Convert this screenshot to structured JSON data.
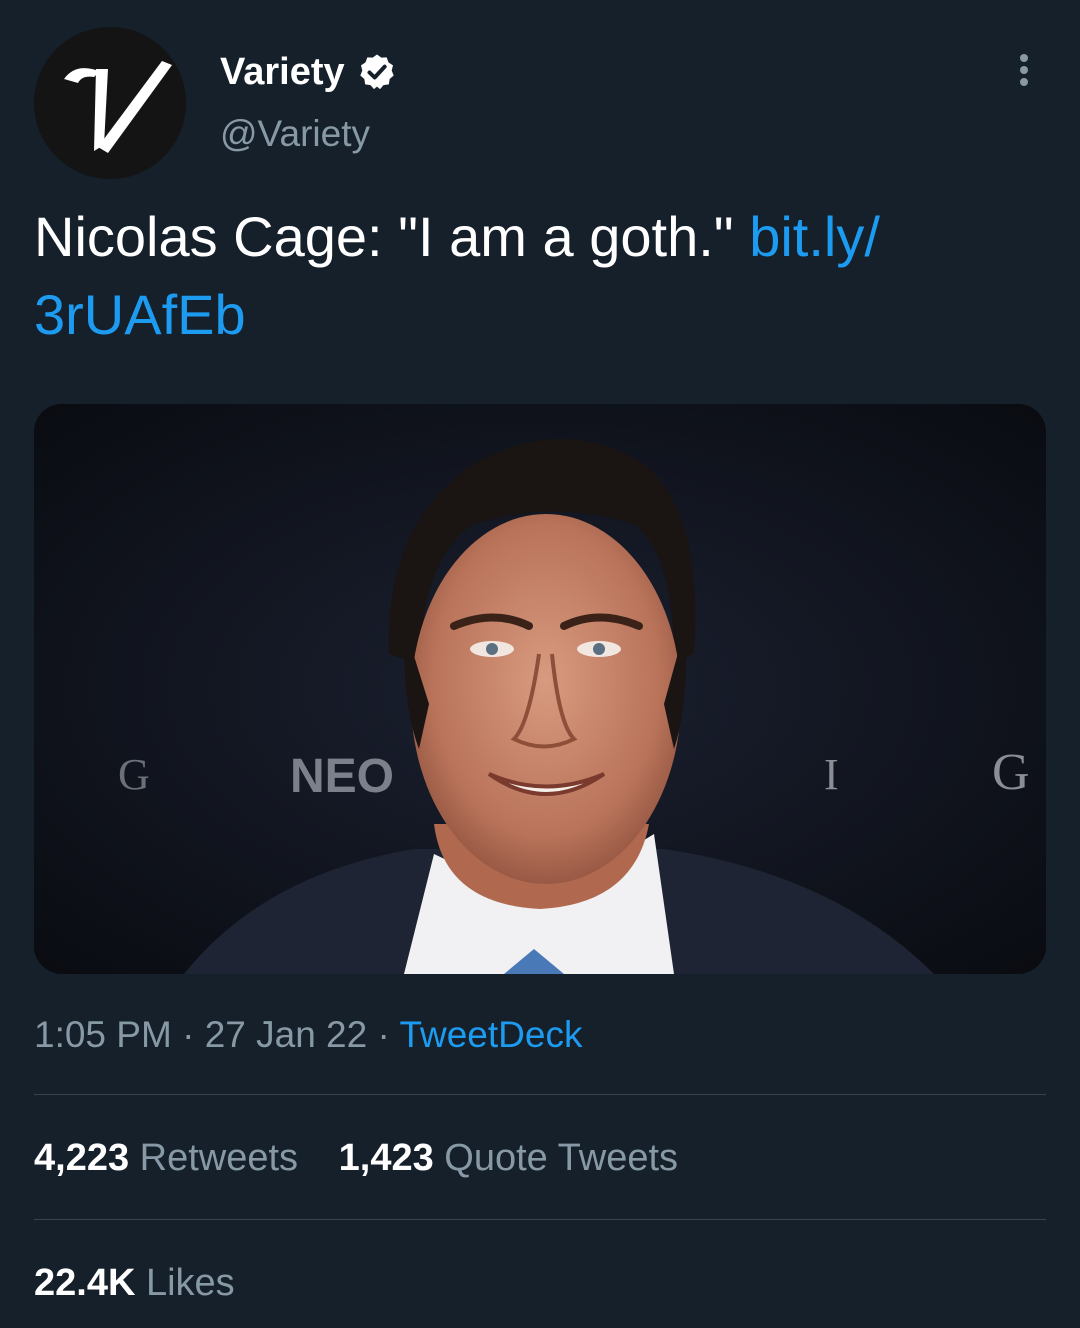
{
  "author": {
    "display_name": "Variety",
    "handle": "@Variety",
    "avatar_letter": "V"
  },
  "tweet": {
    "text": "Nicolas Cage: \"I am a goth.\" ",
    "link_line1": "bit.ly/",
    "link_line2": "3rUAfEb"
  },
  "media": {
    "backdrop_letters": [
      "G",
      "NEO",
      "I",
      "G"
    ]
  },
  "meta": {
    "time": "1:05 PM",
    "sep1": " · ",
    "date": "27 Jan 22",
    "sep2": " · ",
    "source": "TweetDeck"
  },
  "stats": {
    "retweets_count": "4,223",
    "retweets_label": "Retweets",
    "quotes_count": "1,423",
    "quotes_label": "Quote Tweets",
    "likes_count": "22.4K",
    "likes_label": "Likes"
  },
  "colors": {
    "background": "#15202b",
    "link": "#1d9bf0",
    "secondary_text": "#8899a6",
    "divider": "#38444d"
  },
  "icons": [
    "verified-badge-icon",
    "more-options-icon"
  ]
}
